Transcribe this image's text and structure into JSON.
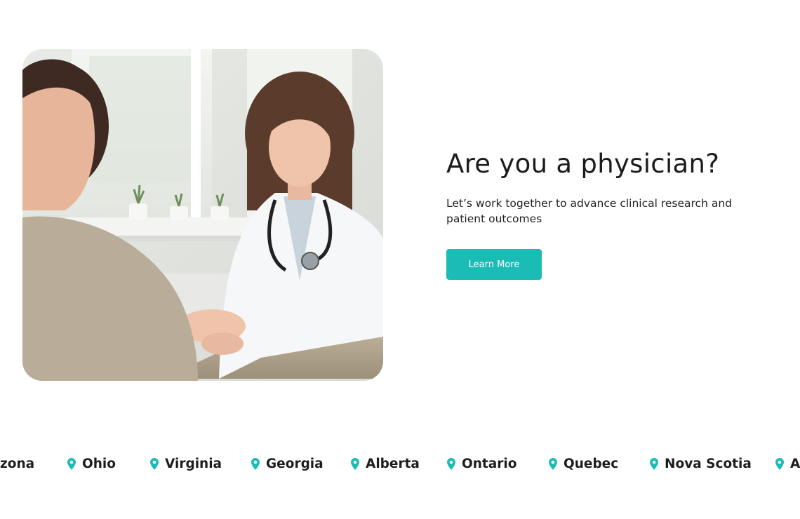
{
  "hero": {
    "image_alt": "Physician consulting with a patient",
    "headline": "Are you a physician?",
    "subtext": "Let’s work together to advance clinical research and patient outcomes",
    "button_label": "Learn More"
  },
  "colors": {
    "accent": "#1bbcb6",
    "text": "#1c1c1c"
  },
  "locations": {
    "icon": "location-pin-icon",
    "items": [
      "zona",
      "Ohio",
      "Virginia",
      "Georgia",
      "Alberta",
      "Ontario",
      "Quebec",
      "Nova Scotia",
      "Ar"
    ]
  }
}
